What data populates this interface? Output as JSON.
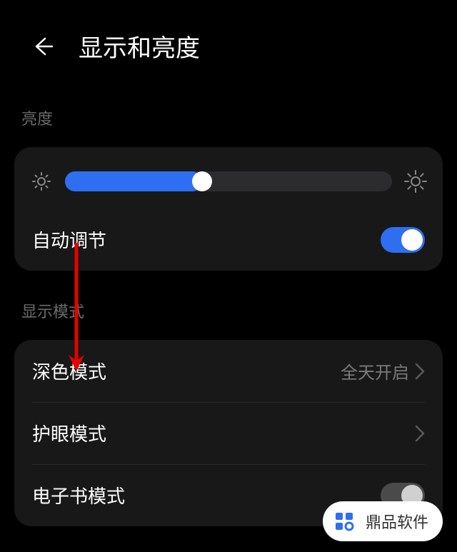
{
  "header": {
    "title": "显示和亮度"
  },
  "sections": {
    "brightness": {
      "label": "亮度",
      "slider_percent": 42,
      "auto_label": "自动调节",
      "auto_on": true
    },
    "display_mode": {
      "label": "显示模式",
      "items": [
        {
          "label": "深色模式",
          "value": "全天开启",
          "type": "link"
        },
        {
          "label": "护眼模式",
          "value": "",
          "type": "link"
        },
        {
          "label": "电子书模式",
          "type": "toggle",
          "on": false
        }
      ]
    }
  },
  "watermark": {
    "text": "鼎品软件"
  }
}
